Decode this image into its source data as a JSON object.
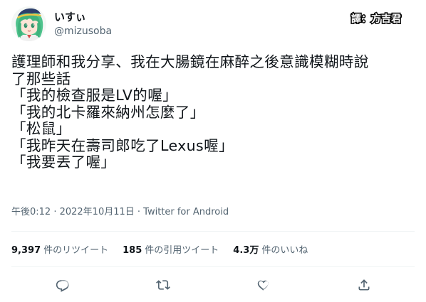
{
  "user": {
    "display_name": "いすぃ",
    "handle": "@mizusoba",
    "avatar": "green-haired-character-avatar"
  },
  "watermark": {
    "text": "譯：方吉君"
  },
  "tweet": {
    "lines": [
      "護理師和我分享、我在大腸鏡在麻醉之後意識模糊時說",
      "了那些話",
      "「我的檢查服是LV的喔」",
      "「我的北卡羅來納州怎麼了」",
      "「松鼠」",
      "「我昨天在壽司郎吃了Lexus喔」",
      "「我要丟了喔」"
    ],
    "meta": "午後0:12 · 2022年10月11日 · Twitter for Android"
  },
  "stats": {
    "retweets": {
      "count": "9,397",
      "label": "件のリツイート"
    },
    "quotes": {
      "count": "185",
      "label": "件の引用ツイート"
    },
    "likes": {
      "count": "4.3万",
      "label": "件のいいね"
    }
  },
  "actions": {
    "reply": "reply-icon",
    "retweet": "retweet-icon",
    "like": "heart-icon",
    "share": "share-icon"
  },
  "colors": {
    "text": "#0f1419",
    "secondary": "#536471",
    "divider": "#eff3f4",
    "icon": "#536471"
  }
}
